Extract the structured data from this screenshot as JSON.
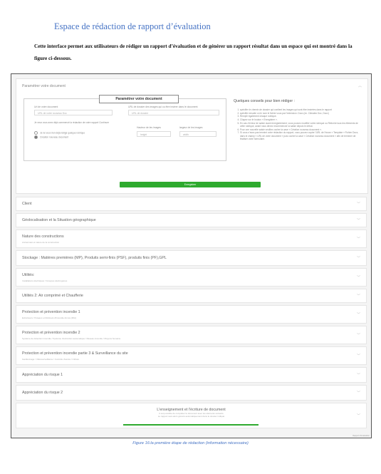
{
  "document": {
    "heading": "Espace de rédaction de rapport d’évaluation",
    "intro": "Cette interface permet aux utilisateurs de rédiger un rapport d’évaluation et de générer  un rapport résultat dans  un   espace qui est montré dans la figure ci-dessous.",
    "caption": "Figure 16:la première étape de rédaction (information nécessaire)"
  },
  "app": {
    "panel_header": "Paramétrer votre document",
    "form": {
      "legend": "Paramétrer votre document",
      "url_label": "Url de votre document",
      "url_placeholder": "URL de votre nouveau   Doc",
      "folder_label": "URL de dossier des images qui ou être insérer dans le document",
      "folder_placeholder": "URL de dossier",
      "note": "Je veux vous avez déjà commencé la rédaction de votre rapport Continuer",
      "radio_existing": "Je ne veux rien déjà rédigé quelque rubrique",
      "radio_new": "Création nouveau document",
      "height_label": "Hauteur de les images",
      "height_placeholder": "height",
      "width_label": "largeur de les images",
      "width_placeholder": "width"
    },
    "tips": {
      "title": "Quelques conseils pour bien rédiger :",
      "items": [
        "spécifier le chemin de dossier qui contient les images qui sont être insérées dans le rapport",
        "spécifier ensuite où le nom le fichier vous par l'extension .Docx (ex. Climatex Doc, Docx)",
        "Remplir également chaque rubrique.",
        "Cliquez sur le bouton « Enregistrer ».",
        "En cas d'erreur de saisie avant enregistrement, vous pouvez modifier votre rubrique ou Réécrire tous les éléments de cette rubrique, avant nous devez recommencer la saisie depuis le début.",
        "Pour une nouvelle saisie veuillez cocher la case « Création nouveau document ».",
        "Si vous n'avez pas terminé votre rédaction du rapport, vous pouvez copier l'URL de l'écran « Template » Fichier Docx, dans le champ « URL de votre document » puis cocher la case « Création nouveau document » afin de terminer de finaliser votre formulaire."
      ]
    },
    "save_button": "Enregistrer",
    "sections": [
      {
        "title": "Client",
        "sub": ""
      },
      {
        "title": "Géolocalisation et la Situation géographique",
        "sub": ""
      },
      {
        "title": "Nature des constructions",
        "sub": "Ancienneté et nature de la construction"
      },
      {
        "title": "Stockage : Matières premières (MP), Produits semi-finis (PSF), produits finis (PF),GPL",
        "sub": ""
      },
      {
        "title": "Utilités:",
        "sub": "Installations électriques / Groupes électrogènes"
      },
      {
        "title": "Utilités 2: Air comprimé et Chaufferie",
        "sub": ""
      },
      {
        "title": "Protection et prévention incendie 1",
        "sub": "Extincteurs / Poteaux et Robinets d'Incendie Armés (RIA)"
      },
      {
        "title": "Protection et prévention incendie 2",
        "sub": "Système de détection incendie / Système d'extinction automatique / Réseau incendie / Moyens humains"
      },
      {
        "title": "Protection et prévention incendie partie 3 & Surveillance du site",
        "sub": "Gardiennage / Vidéosurveillance / Contrôle d'accès / Clôture"
      },
      {
        "title": "Appréciation du risque 1",
        "sub": ""
      },
      {
        "title": "Appréciation du risque 2",
        "sub": ""
      }
    ],
    "final_section": {
      "title": "L'enseignement et l'écriture de document",
      "line1": "Il est possible de compléter le document avec les éléments suivants",
      "line2": "Le rapport sera alors généré automatiquement dans le dossier indiqué"
    },
    "footer_note": "Rapport d'évaluation"
  }
}
